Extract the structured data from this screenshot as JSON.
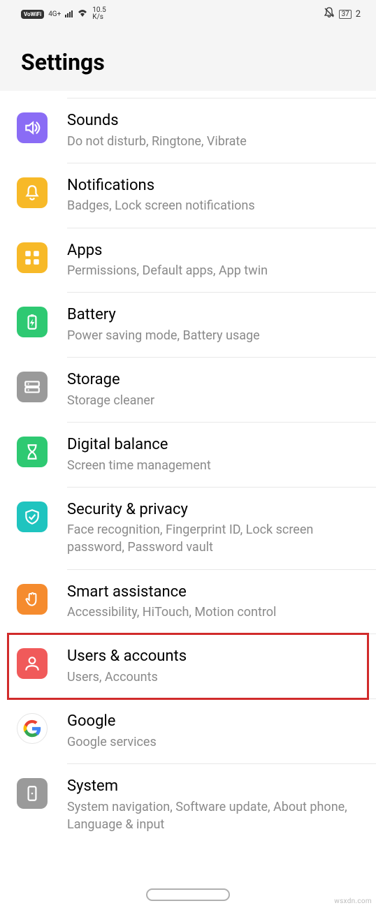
{
  "status": {
    "vowifi": "VoWiFi",
    "network": "4G+",
    "speed_value": "10.5",
    "speed_unit": "K/s",
    "battery": "37",
    "extra": "2"
  },
  "header": {
    "title": "Settings"
  },
  "items": [
    {
      "title": "Sounds",
      "subtitle": "Do not disturb, Ringtone, Vibrate",
      "color": "#8a6cf5",
      "icon": "sound"
    },
    {
      "title": "Notifications",
      "subtitle": "Badges, Lock screen notifications",
      "color": "#f7b928",
      "icon": "bell"
    },
    {
      "title": "Apps",
      "subtitle": "Permissions, Default apps, App twin",
      "color": "#f7b928",
      "icon": "apps"
    },
    {
      "title": "Battery",
      "subtitle": "Power saving mode, Battery usage",
      "color": "#2ec972",
      "icon": "battery"
    },
    {
      "title": "Storage",
      "subtitle": "Storage cleaner",
      "color": "#9a9a9a",
      "icon": "storage"
    },
    {
      "title": "Digital balance",
      "subtitle": "Screen time management",
      "color": "#2ec972",
      "icon": "hourglass"
    },
    {
      "title": "Security & privacy",
      "subtitle": "Face recognition, Fingerprint ID, Lock screen password, Password vault",
      "color": "#1fc4bf",
      "icon": "shield"
    },
    {
      "title": "Smart assistance",
      "subtitle": "Accessibility, HiTouch, Motion control",
      "color": "#f58b2e",
      "icon": "hand"
    },
    {
      "title": "Users & accounts",
      "subtitle": "Users, Accounts",
      "color": "#f05a5a",
      "icon": "user",
      "highlight": true
    },
    {
      "title": "Google",
      "subtitle": "Google services",
      "color": "#ffffff",
      "icon": "google"
    },
    {
      "title": "System",
      "subtitle": "System navigation, Software update, About phone, Language & input",
      "color": "#9a9a9a",
      "icon": "system"
    }
  ],
  "watermark": "wsxdn.com"
}
